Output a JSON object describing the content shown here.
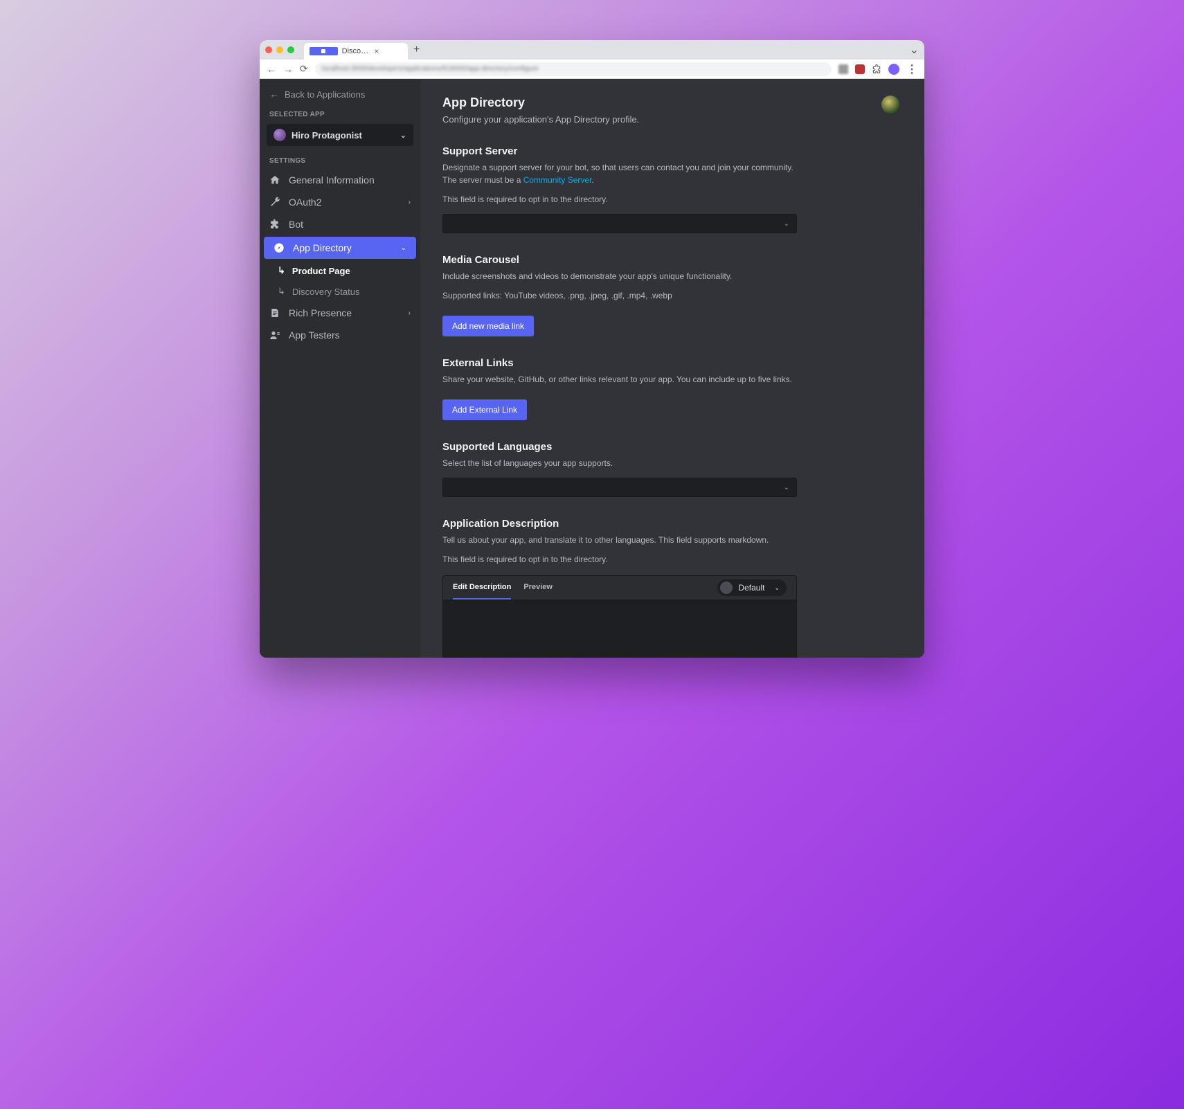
{
  "browser": {
    "tab_title": "Discord Developer Portal — My…",
    "url_blur": "localhost:3000/developers/applications/918000/app-directory/configure"
  },
  "sidebar": {
    "back": "Back to Applications",
    "selected_app_heading": "Selected App",
    "selected_app_name": "Hiro Protagonist",
    "settings_heading": "Settings",
    "items": {
      "general": "General Information",
      "oauth": "OAuth2",
      "bot": "Bot",
      "appdir": "App Directory",
      "appdir_sub": {
        "product": "Product Page",
        "discovery": "Discovery Status"
      },
      "rich": "Rich Presence",
      "testers": "App Testers"
    }
  },
  "page": {
    "title": "App Directory",
    "subtitle": "Configure your application's App Directory profile."
  },
  "support": {
    "heading": "Support Server",
    "desc_pre": "Designate a support server for your bot, so that users can contact you and join your community. The server must be a ",
    "link": "Community Server",
    "desc_post": ".",
    "note": "This field is required to opt in to the directory."
  },
  "media": {
    "heading": "Media Carousel",
    "desc": "Include screenshots and videos to demonstrate your app's unique functionality.",
    "note": "Supported links: YouTube videos, .png, .jpeg, .gif, .mp4, .webp",
    "button": "Add new media link"
  },
  "links": {
    "heading": "External Links",
    "desc": "Share your website, GitHub, or other links relevant to your app. You can include up to five links.",
    "button": "Add External Link"
  },
  "langs": {
    "heading": "Supported Languages",
    "desc": "Select the list of languages your app supports."
  },
  "appdesc": {
    "heading": "Application Description",
    "desc": "Tell us about your app, and translate it to other languages. This field supports markdown.",
    "note": "This field is required to opt in to the directory.",
    "tab_edit": "Edit Description",
    "tab_preview": "Preview",
    "lang_selected": "Default"
  }
}
